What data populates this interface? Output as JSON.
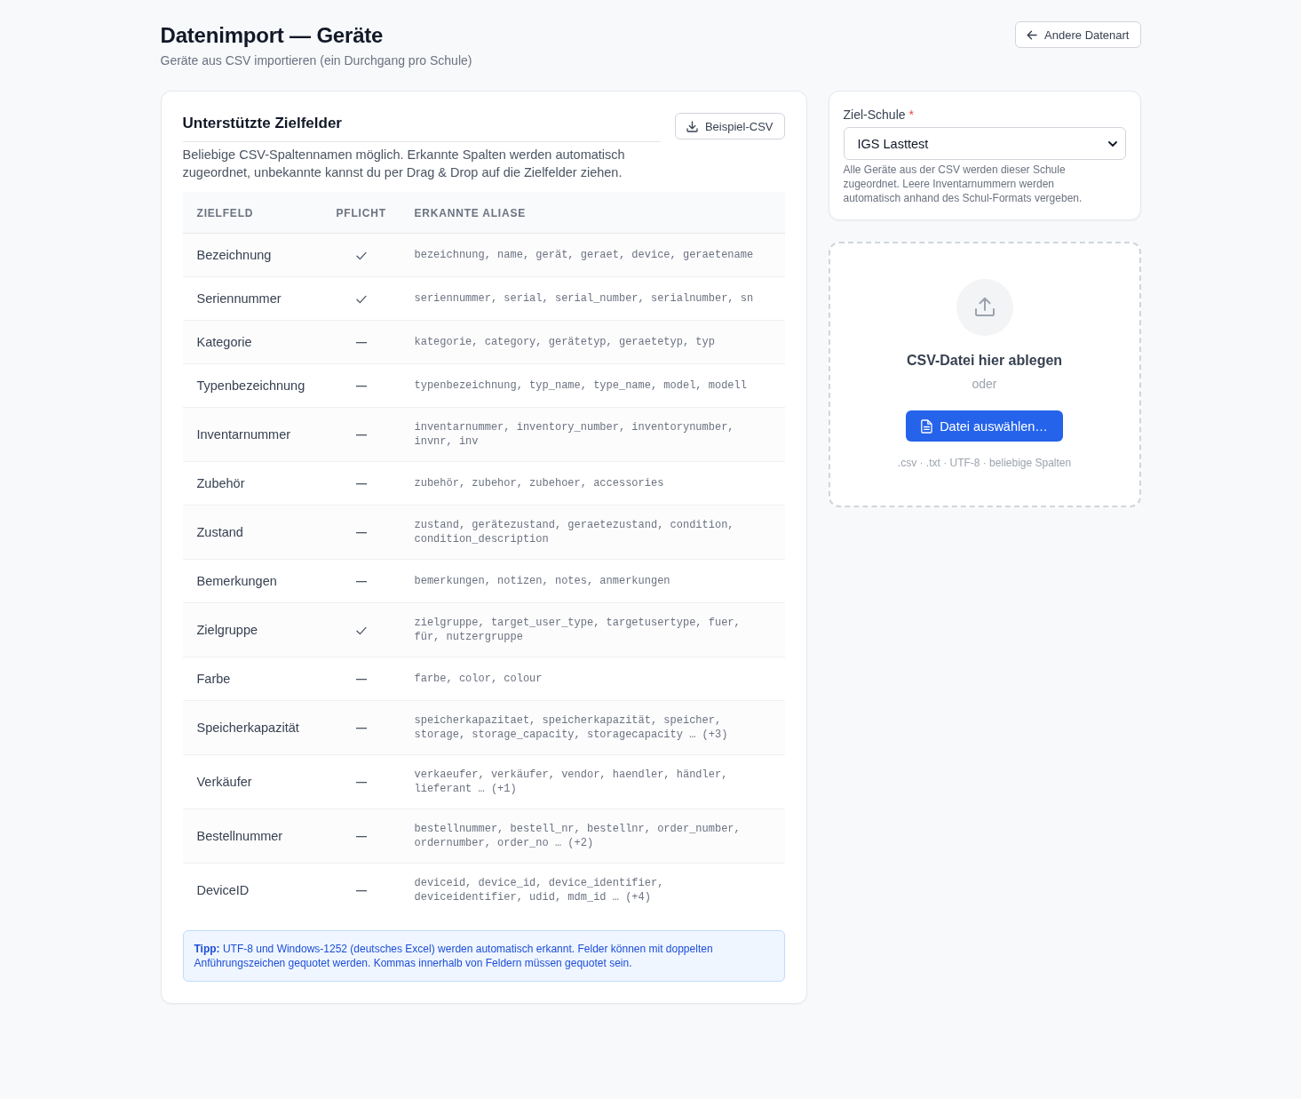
{
  "header": {
    "title": "Datenimport — Geräte",
    "subtitle": "Geräte aus CSV importieren (ein Durchgang pro Schule)",
    "back_button": "Andere Datenart"
  },
  "fields_card": {
    "title": "Unterstützte Zielfelder",
    "description": "Beliebige CSV-Spaltennamen möglich. Erkannte Spalten werden automatisch zugeordnet, unbekannte kannst du per Drag & Drop auf die Zielfelder ziehen.",
    "sample_button": "Beispiel-CSV",
    "table": {
      "columns": [
        "ZIELFELD",
        "PFLICHT",
        "ERKANNTE ALIASE"
      ],
      "rows": [
        {
          "field": "Bezeichnung",
          "required": true,
          "aliases": "bezeichnung, name, gerät, geraet, device, geraetename"
        },
        {
          "field": "Seriennummer",
          "required": true,
          "aliases": "seriennummer, serial, serial_number, serialnumber, sn"
        },
        {
          "field": "Kategorie",
          "required": false,
          "aliases": "kategorie, category, gerätetyp, geraetetyp, typ"
        },
        {
          "field": "Typenbezeichnung",
          "required": false,
          "aliases": "typenbezeichnung, typ_name, type_name, model, modell"
        },
        {
          "field": "Inventarnummer",
          "required": false,
          "aliases": "inventarnummer, inventory_number, inventorynumber, invnr, inv"
        },
        {
          "field": "Zubehör",
          "required": false,
          "aliases": "zubehör, zubehor, zubehoer, accessories"
        },
        {
          "field": "Zustand",
          "required": false,
          "aliases": "zustand, gerätezustand, geraetezustand, condition, condition_description"
        },
        {
          "field": "Bemerkungen",
          "required": false,
          "aliases": "bemerkungen, notizen, notes, anmerkungen"
        },
        {
          "field": "Zielgruppe",
          "required": true,
          "aliases": "zielgruppe, target_user_type, targetusertype, fuer, für, nutzergruppe"
        },
        {
          "field": "Farbe",
          "required": false,
          "aliases": "farbe, color, colour"
        },
        {
          "field": "Speicherkapazität",
          "required": false,
          "aliases": "speicherkapazitaet, speicherkapazität, speicher, storage, storage_capacity, storagecapacity … (+3)"
        },
        {
          "field": "Verkäufer",
          "required": false,
          "aliases": "verkaeufer, verkäufer, vendor, haendler, händler, lieferant … (+1)"
        },
        {
          "field": "Bestellnummer",
          "required": false,
          "aliases": "bestellnummer, bestell_nr, bestellnr, order_number, ordernumber, order_no … (+2)"
        },
        {
          "field": "DeviceID",
          "required": false,
          "aliases": "deviceid, device_id, device_identifier, deviceidentifier, udid, mdm_id … (+4)"
        }
      ]
    },
    "tip": "**Tipp:** UTF-8 und Windows-1252 (deutsches Excel) werden automatisch erkannt. Felder können mit doppelten Anführungszeichen gequotet werden. Kommas innerhalb von Feldern müssen gequotet sein."
  },
  "school_card": {
    "label": "Ziel-Schule",
    "required_mark": "*",
    "value": "IGS Lasttest",
    "help": "Alle Geräte aus der CSV werden dieser Schule zugeordnet. Leere Inventarnummern werden automatisch anhand des Schul-Formats vergeben."
  },
  "dropzone": {
    "title": "CSV-Datei hier ablegen",
    "separator": "oder",
    "button": "Datei auswählen…",
    "hint": ".csv · .txt · UTF-8 · beliebige Spalten"
  }
}
